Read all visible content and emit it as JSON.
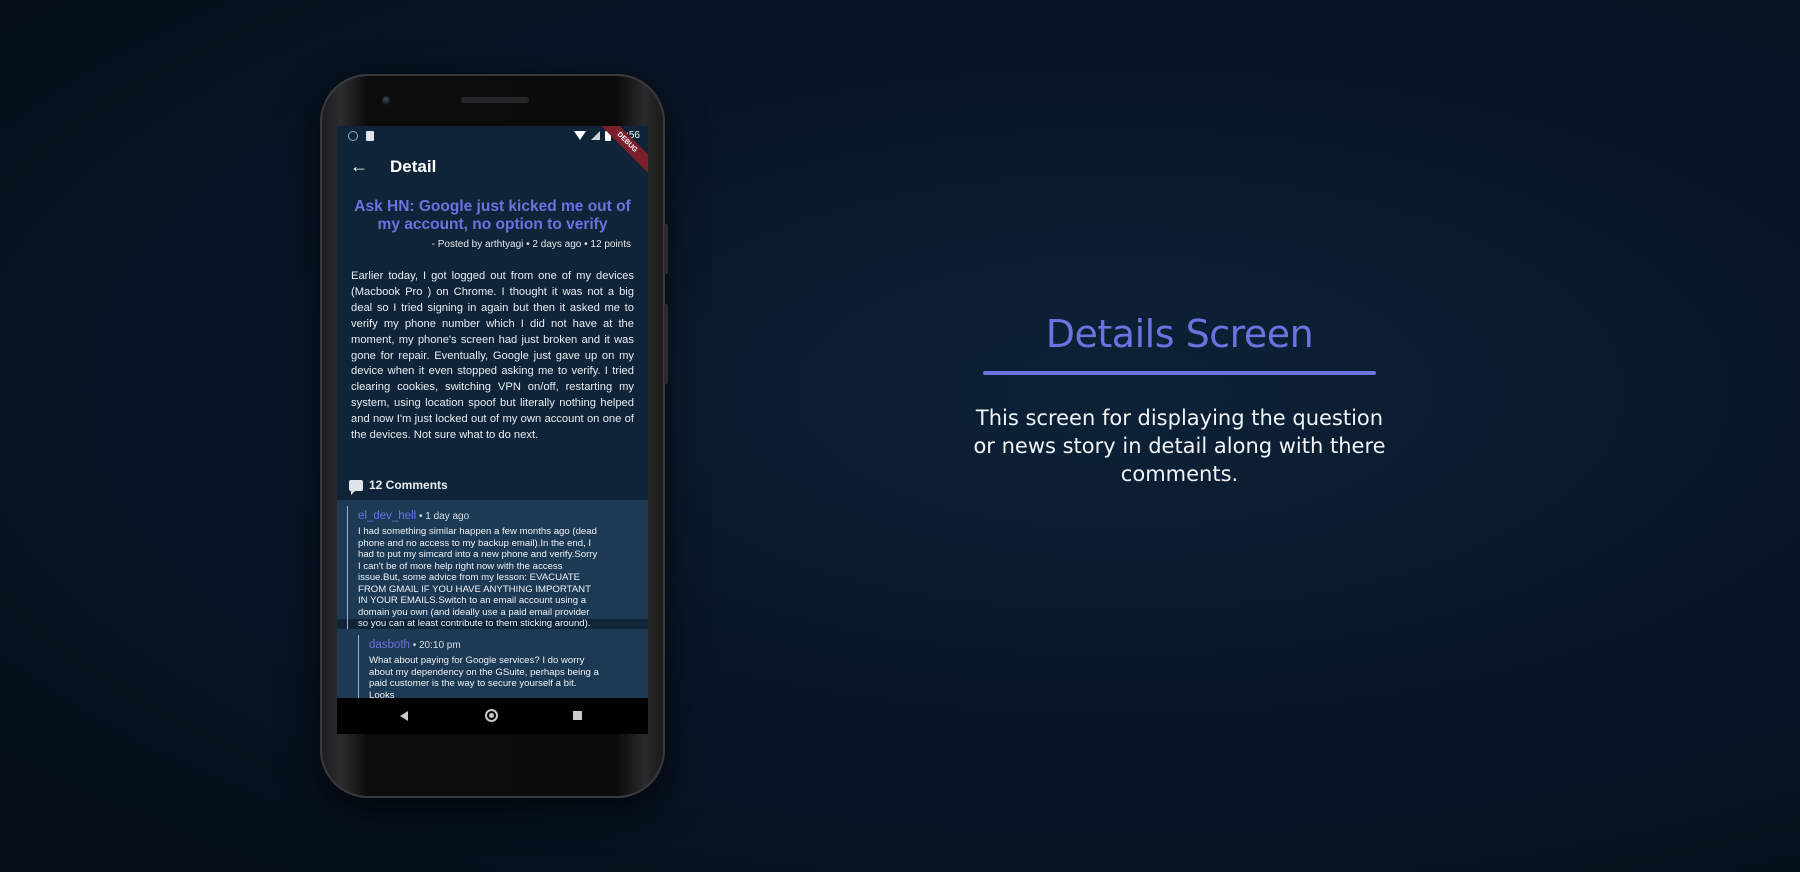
{
  "status_bar": {
    "time": "11:56",
    "debug_label": "DEBUG"
  },
  "app_bar": {
    "title": "Detail",
    "back_icon": "arrow-left-icon"
  },
  "post": {
    "title": "Ask HN: Google just kicked me out of my account, no option to verify",
    "meta": "- Posted by arthtyagi • 2 days ago • 12 points",
    "body": "Earlier today, I got logged out from one of my devices (Macbook Pro ) on Chrome. I thought it was not a big deal so I tried signing in again but then it asked me to verify my phone number which I did not have at the moment, my phone's screen had just broken and it was gone for repair. Eventually, Google just gave up on my device when it even stopped asking me to verify. I tried clearing cookies, switching VPN on/off, restarting my system, using location spoof but literally nothing helped and now I'm just locked out of my own account on one of the devices. Not sure what to do next."
  },
  "comments": {
    "count_label": "12 Comments",
    "items": [
      {
        "author": "el_dev_hell",
        "time": " • 1 day ago",
        "text": "I had something similar happen a few months ago (dead phone and no access to my backup email).In the end, I had to put my simcard into a new phone and verify.Sorry I can't be of more help right now with the access issue.But, some advice from my lesson: EVACUATE FROM GMAIL IF YOU HAVE ANYTHING IMPORTANT IN YOUR EMAILS.Switch to an email account using a domain you own (and ideally use a paid email provider so you can at least contribute to them sticking around)."
      },
      {
        "author": "dasboth",
        "time": " • 20:10 pm",
        "text": "What about paying for Google services? I do worry about my dependency on the GSuite, perhaps being a paid customer is the way to secure yourself a bit. Looks"
      }
    ]
  },
  "hero": {
    "title": "Details Screen",
    "description": "This screen for displaying the question or news story in detail along with there comments."
  },
  "colors": {
    "accent": "#6b73e0",
    "screen_bg": "#0f2438",
    "comment_bg": "#1d3a55",
    "page_bg": "#081627"
  }
}
